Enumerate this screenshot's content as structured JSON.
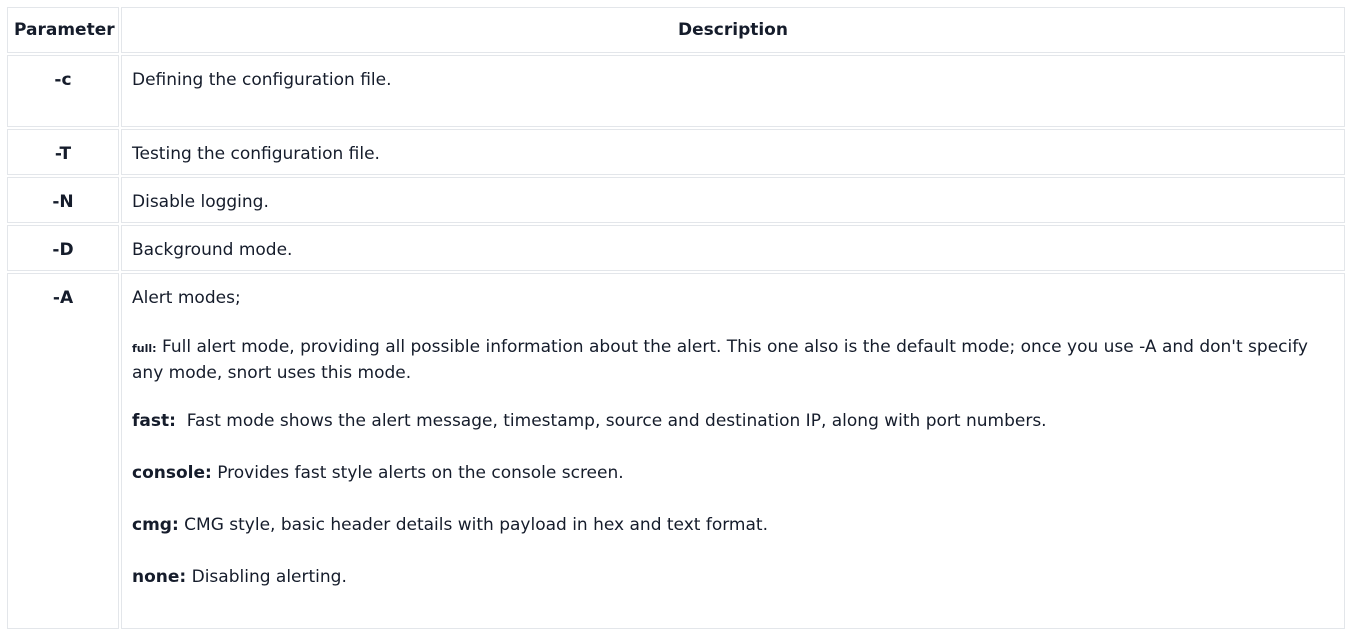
{
  "headers": {
    "parameter": "Parameter",
    "description": "Description"
  },
  "rows": [
    {
      "param": "-c",
      "desc": "Defining the configuration file."
    },
    {
      "param": "-T",
      "desc": "Testing the configuration file."
    },
    {
      "param": "-N",
      "desc": "Disable logging."
    },
    {
      "param": "-D",
      "desc": "Background mode."
    }
  ],
  "alert": {
    "param": "-A",
    "intro": "Alert modes;",
    "modes": [
      {
        "name": "full:",
        "text": " Full alert mode, providing all possible information about the alert. This one also is the default mode; once you use -A and don't specify any mode, snort uses this mode."
      },
      {
        "name": "fast:",
        "text": "  Fast mode shows the alert message, timestamp, source and destination IP, along with port numbers."
      },
      {
        "name": "console:",
        "text": " Provides fast style alerts on the console screen."
      },
      {
        "name": "cmg:",
        "text": " CMG style, basic header details with payload in hex and text format."
      },
      {
        "name": "none:",
        "text": " Disabling alerting."
      }
    ]
  }
}
